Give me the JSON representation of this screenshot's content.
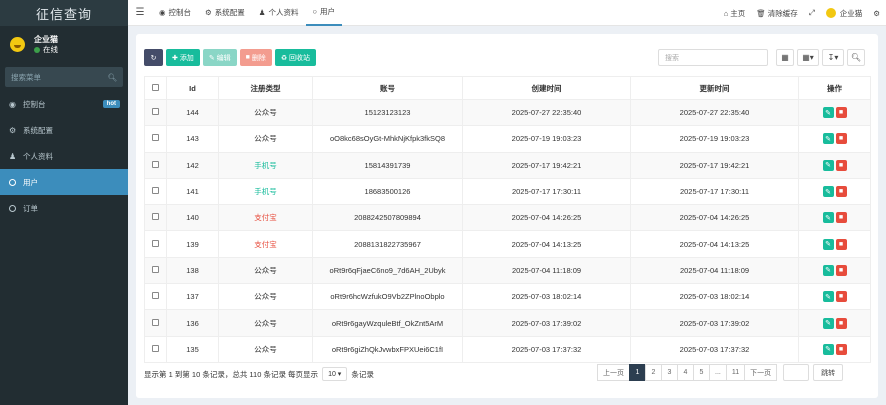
{
  "app": {
    "title": "征信查询"
  },
  "user": {
    "name": "企业猫",
    "status": "在线"
  },
  "sidebar": {
    "search_placeholder": "搜索菜单",
    "items": [
      {
        "label": "控制台",
        "icon": "dashboard-icon",
        "badge": "hot"
      },
      {
        "label": "系统配置",
        "icon": "gear-icon"
      },
      {
        "label": "个人资料",
        "icon": "user-icon"
      },
      {
        "label": "用户",
        "icon": "circle-icon",
        "active": true
      },
      {
        "label": "订单",
        "icon": "circle-icon"
      }
    ]
  },
  "header": {
    "tabs": [
      {
        "label": "控制台",
        "icon": "dashboard-icon"
      },
      {
        "label": "系统配置",
        "icon": "gear-icon"
      },
      {
        "label": "个人资料",
        "icon": "user-icon"
      },
      {
        "label": "用户",
        "icon": "circle-icon",
        "active": true
      }
    ],
    "right": {
      "home": "主页",
      "clear_cache": "清除缓存",
      "user": "企业猫"
    }
  },
  "toolbar": {
    "add": "添加",
    "edit": "编辑",
    "delete": "删除",
    "recycle": "回收站",
    "search_placeholder": "搜索"
  },
  "table": {
    "columns": [
      "Id",
      "注册类型",
      "账号",
      "创建时间",
      "更新时间",
      "操作"
    ],
    "rows": [
      {
        "id": "144",
        "type": "公众号",
        "account": "15123123123",
        "created": "2025-07-27 22:35:40",
        "updated": "2025-07-27 22:35:40"
      },
      {
        "id": "143",
        "type": "公众号",
        "account": "oO8kc68sOyGt-MhkNjKfpk3fkSQ8",
        "created": "2025-07-19 19:03:23",
        "updated": "2025-07-19 19:03:23"
      },
      {
        "id": "142",
        "type": "手机号",
        "account": "15814391739",
        "created": "2025-07-17 19:42:21",
        "updated": "2025-07-17 19:42:21"
      },
      {
        "id": "141",
        "type": "手机号",
        "account": "18683500126",
        "created": "2025-07-17 17:30:11",
        "updated": "2025-07-17 17:30:11"
      },
      {
        "id": "140",
        "type": "支付宝",
        "account": "2088242507809894",
        "created": "2025-07-04 14:26:25",
        "updated": "2025-07-04 14:26:25"
      },
      {
        "id": "139",
        "type": "支付宝",
        "account": "2088131822735967",
        "created": "2025-07-04 14:13:25",
        "updated": "2025-07-04 14:13:25"
      },
      {
        "id": "138",
        "type": "公众号",
        "account": "oRt9r6qFjaeC6no9_7d6AH_2Ubyk",
        "created": "2025-07-04 11:18:09",
        "updated": "2025-07-04 11:18:09"
      },
      {
        "id": "137",
        "type": "公众号",
        "account": "oRt9r6hcWzfukO9Vb2ZPlnoObplo",
        "created": "2025-07-03 18:02:14",
        "updated": "2025-07-03 18:02:14"
      },
      {
        "id": "136",
        "type": "公众号",
        "account": "oRt9r6gayWzquleBtf_OkZnt5ArM",
        "created": "2025-07-03 17:39:02",
        "updated": "2025-07-03 17:39:02"
      },
      {
        "id": "135",
        "type": "公众号",
        "account": "oRt9r6giZhQkJvwbxFPXUei6C1fI",
        "created": "2025-07-03 17:37:32",
        "updated": "2025-07-03 17:37:32"
      }
    ]
  },
  "footer": {
    "info_prefix": "显示第 1 到第 10 条记录，总共 110 条记录 每页显示",
    "page_size": "10",
    "info_suffix": "条记录",
    "pages": [
      "上一页",
      "1",
      "2",
      "3",
      "4",
      "5",
      "...",
      "11",
      "下一页"
    ],
    "current_page": "1",
    "jump": "跳转"
  },
  "colors": {
    "sidebar": "#222d32",
    "accent": "#3c8dbc",
    "green": "#18bc9c",
    "red": "#e74c3c"
  }
}
